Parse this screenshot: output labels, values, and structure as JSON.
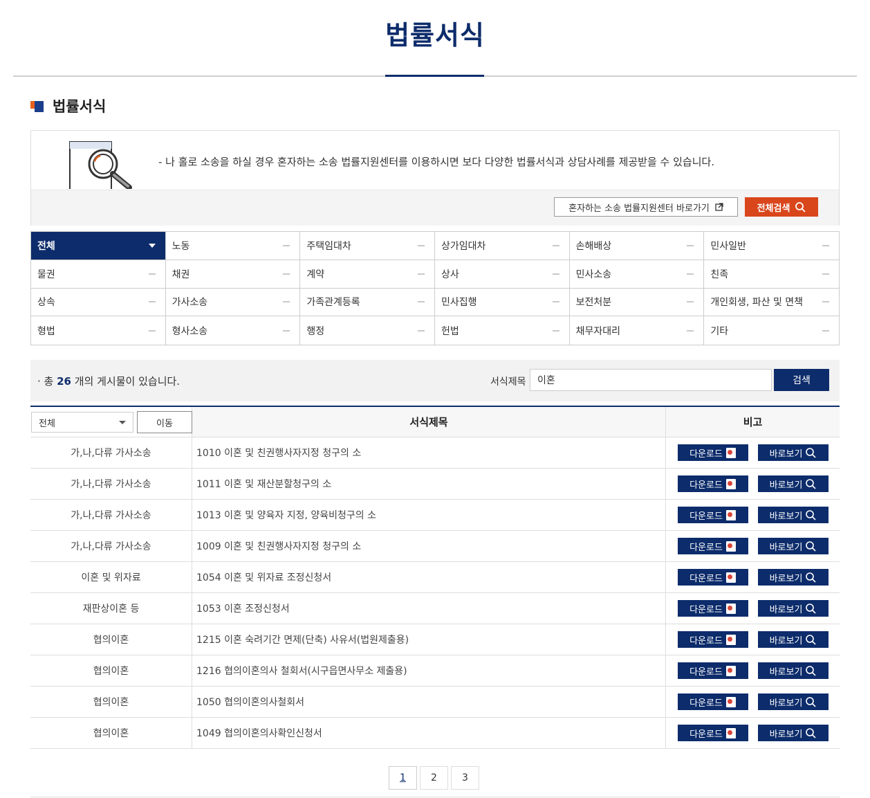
{
  "page": {
    "title": "법률서식"
  },
  "section": {
    "title": "법률서식"
  },
  "info": {
    "text": "- 나 홀로 소송을 하실 경우 혼자하는 소송 법률지원센터를 이용하시면 보다 다양한 법률서식과 상담사례를 제공받을 수 있습니다.",
    "link_label": "혼자하는 소송 법률지원센터 바로가기",
    "search_all_label": "전체검색"
  },
  "categories": [
    {
      "label": "전체",
      "active": true
    },
    {
      "label": "노동"
    },
    {
      "label": "주택임대차"
    },
    {
      "label": "상가임대차"
    },
    {
      "label": "손해배상"
    },
    {
      "label": "민사일반"
    },
    {
      "label": "물권"
    },
    {
      "label": "채권"
    },
    {
      "label": "계약"
    },
    {
      "label": "상사"
    },
    {
      "label": "민사소송"
    },
    {
      "label": "친족"
    },
    {
      "label": "상속"
    },
    {
      "label": "가사소송"
    },
    {
      "label": "가족관계등록"
    },
    {
      "label": "민사집행"
    },
    {
      "label": "보전처분"
    },
    {
      "label": "개인회생, 파산 및 면책"
    },
    {
      "label": "형법"
    },
    {
      "label": "형사소송"
    },
    {
      "label": "행정"
    },
    {
      "label": "헌법"
    },
    {
      "label": "채무자대리"
    },
    {
      "label": "기타"
    }
  ],
  "search": {
    "count_prefix": "· 총 ",
    "count": "26",
    "count_suffix": " 개의 게시물이 있습니다.",
    "field_label": "서식제목",
    "value": "이혼",
    "button": "검색"
  },
  "table": {
    "filter_value": "전체",
    "move_label": "이동",
    "col_title": "서식제목",
    "col_note": "비고",
    "download_label": "다운로드",
    "view_label": "바로보기",
    "rows": [
      {
        "category": "가,나,다류 가사소송",
        "title": "1010 이혼 및 친권행사자지정 청구의 소"
      },
      {
        "category": "가,나,다류 가사소송",
        "title": "1011 이혼 및 재산분할청구의 소"
      },
      {
        "category": "가,나,다류 가사소송",
        "title": "1013 이혼 및 양육자 지정, 양육비청구의 소"
      },
      {
        "category": "가,나,다류 가사소송",
        "title": "1009 이혼 및 친권행사자지정 청구의 소"
      },
      {
        "category": "이혼 및 위자료",
        "title": "1054 이혼 및 위자료 조정신청서"
      },
      {
        "category": "재판상이혼 등",
        "title": "1053 이혼 조정신청서"
      },
      {
        "category": "협의이혼",
        "title": "1215 이혼 숙려기간 면제(단축) 사유서(법원제출용)"
      },
      {
        "category": "협의이혼",
        "title": "1216 협의이혼의사 철회서(시구읍면사무소 제출용)"
      },
      {
        "category": "협의이혼",
        "title": "1050 협의이혼의사철회서"
      },
      {
        "category": "협의이혼",
        "title": "1049 협의이혼의사확인신청서"
      }
    ]
  },
  "pagination": {
    "pages": [
      "1",
      "2",
      "3"
    ],
    "current": "1"
  },
  "colors": {
    "navy": "#0d2c6b",
    "orange": "#d9461c"
  }
}
